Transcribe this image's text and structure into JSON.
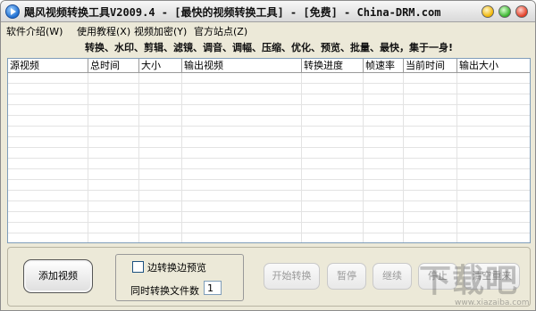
{
  "window": {
    "title": "飓风视频转换工具V2009.4 - [最快的视频转换工具] - [免费] - China-DRM.com"
  },
  "menu": [
    {
      "label": "软件介绍(W)"
    },
    {
      "label": "使用教程(X)"
    },
    {
      "label": "视频加密(Y)"
    },
    {
      "label": "官方站点(Z)"
    }
  ],
  "slogan": "转换、水印、剪辑、滤镜、调音、调幅、压缩、优化、预览、批量、最快，集于一身!",
  "table": {
    "columns": [
      "源视频",
      "总时间",
      "大小",
      "输出视频",
      "转换进度",
      "帧速率",
      "当前时间",
      "输出大小"
    ],
    "rows": []
  },
  "controls": {
    "add_video": "添加视频",
    "preview_checkbox_label": "边转换边预览",
    "preview_checked": false,
    "concurrent_label": "同时转换文件数",
    "concurrent_value": "1"
  },
  "actions": [
    {
      "label": "开始转换"
    },
    {
      "label": "暂停"
    },
    {
      "label": "继续"
    },
    {
      "label": "停止"
    },
    {
      "label": "清空重来"
    }
  ],
  "watermark": {
    "text": "下载吧",
    "sub": "www.xiazaiba.com"
  }
}
